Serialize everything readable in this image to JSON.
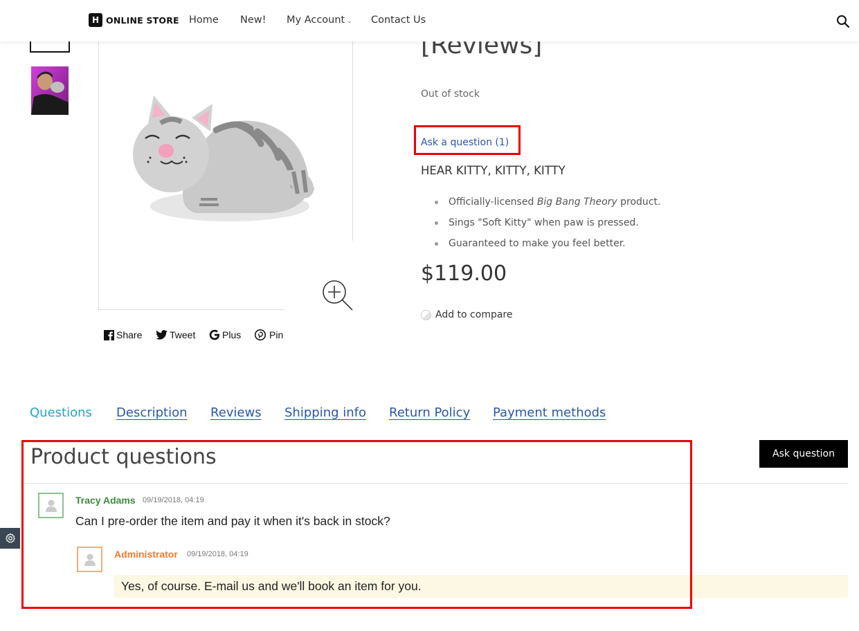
{
  "header": {
    "logo_text": "ONLINE STORE",
    "nav": [
      {
        "label": "Home"
      },
      {
        "label": "New!"
      },
      {
        "label": "My Account",
        "has_dropdown": true
      },
      {
        "label": "Contact Us"
      }
    ],
    "search_icon": "search-icon"
  },
  "product": {
    "title_fragment": "[Reviews]",
    "stock_status": "Out of stock",
    "ask_question_link": "Ask a question (1)",
    "tagline": "HEAR KITTY, KITTY, KITTY",
    "bullets": [
      {
        "before": "Officially-licensed ",
        "italic": "Big Bang Theory",
        "after": " product."
      },
      {
        "text": "Sings \"Soft Kitty\" when paw is pressed."
      },
      {
        "text": "Guaranteed to make you feel better."
      }
    ],
    "price": "$119.00",
    "compare_label": "Add to compare"
  },
  "share": [
    {
      "label": "Share",
      "icon": "facebook-icon"
    },
    {
      "label": "Tweet",
      "icon": "twitter-icon"
    },
    {
      "label": "Plus",
      "icon": "google-icon"
    },
    {
      "label": "Pin",
      "icon": "pinterest-icon"
    }
  ],
  "tabs": [
    {
      "label": "Questions",
      "active": true
    },
    {
      "label": "Description"
    },
    {
      "label": "Reviews"
    },
    {
      "label": "Shipping info"
    },
    {
      "label": "Return Policy"
    },
    {
      "label": "Payment methods"
    }
  ],
  "questions": {
    "title": "Product questions",
    "ask_button": "Ask question",
    "items": [
      {
        "author": "Tracy Adams",
        "date": "09/19/2018, 04:19",
        "text": "Can I pre-order the item and pay it when it's back in stock?",
        "answer": {
          "author": "Administrator",
          "date": "09/19/2018, 04:19",
          "text": "Yes, of course. E-mail us and we'll book an item for you."
        }
      }
    ]
  },
  "colors": {
    "link": "#2a56a8",
    "active_tab": "#23a6c8",
    "highlight_border": "#ee0000",
    "user_name": "#3b8b3b",
    "admin_name": "#f07a30",
    "answer_bg": "#fcf8e3"
  }
}
